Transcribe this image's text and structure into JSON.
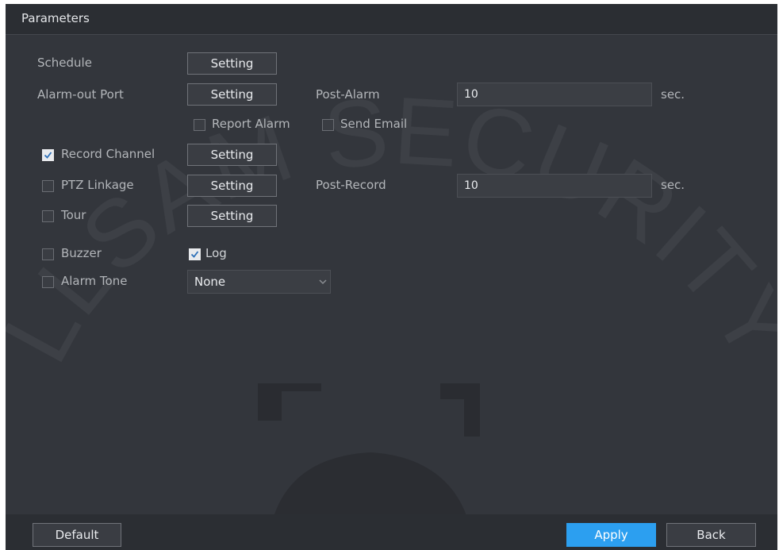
{
  "panel": {
    "title": "Parameters"
  },
  "rows": {
    "schedule": {
      "label": "Schedule",
      "button": "Setting"
    },
    "alarm_out_port": {
      "label": "Alarm-out Port",
      "button": "Setting",
      "post_alarm_label": "Post-Alarm",
      "post_alarm_value": "10",
      "unit": "sec."
    },
    "report_alarm": {
      "label": "Report Alarm",
      "checked": false
    },
    "send_email": {
      "label": "Send Email",
      "checked": false
    },
    "record_channel": {
      "label": "Record Channel",
      "checked": true,
      "button": "Setting"
    },
    "ptz_linkage": {
      "label": "PTZ Linkage",
      "checked": false,
      "button": "Setting",
      "post_record_label": "Post-Record",
      "post_record_value": "10",
      "unit": "sec."
    },
    "tour": {
      "label": "Tour",
      "checked": false,
      "button": "Setting"
    },
    "buzzer": {
      "label": "Buzzer",
      "checked": false
    },
    "log": {
      "label": "Log",
      "checked": true
    },
    "alarm_tone": {
      "label": "Alarm Tone",
      "checked": false,
      "value": "None"
    }
  },
  "footer": {
    "default": "Default",
    "apply": "Apply",
    "back": "Back"
  },
  "watermark": {
    "text": "LLSAM SECURITY"
  },
  "colors": {
    "panel": "#33363c",
    "titlebar": "#2b2e33",
    "accent": "#2c9ff0",
    "text": "#b3b6ba"
  }
}
